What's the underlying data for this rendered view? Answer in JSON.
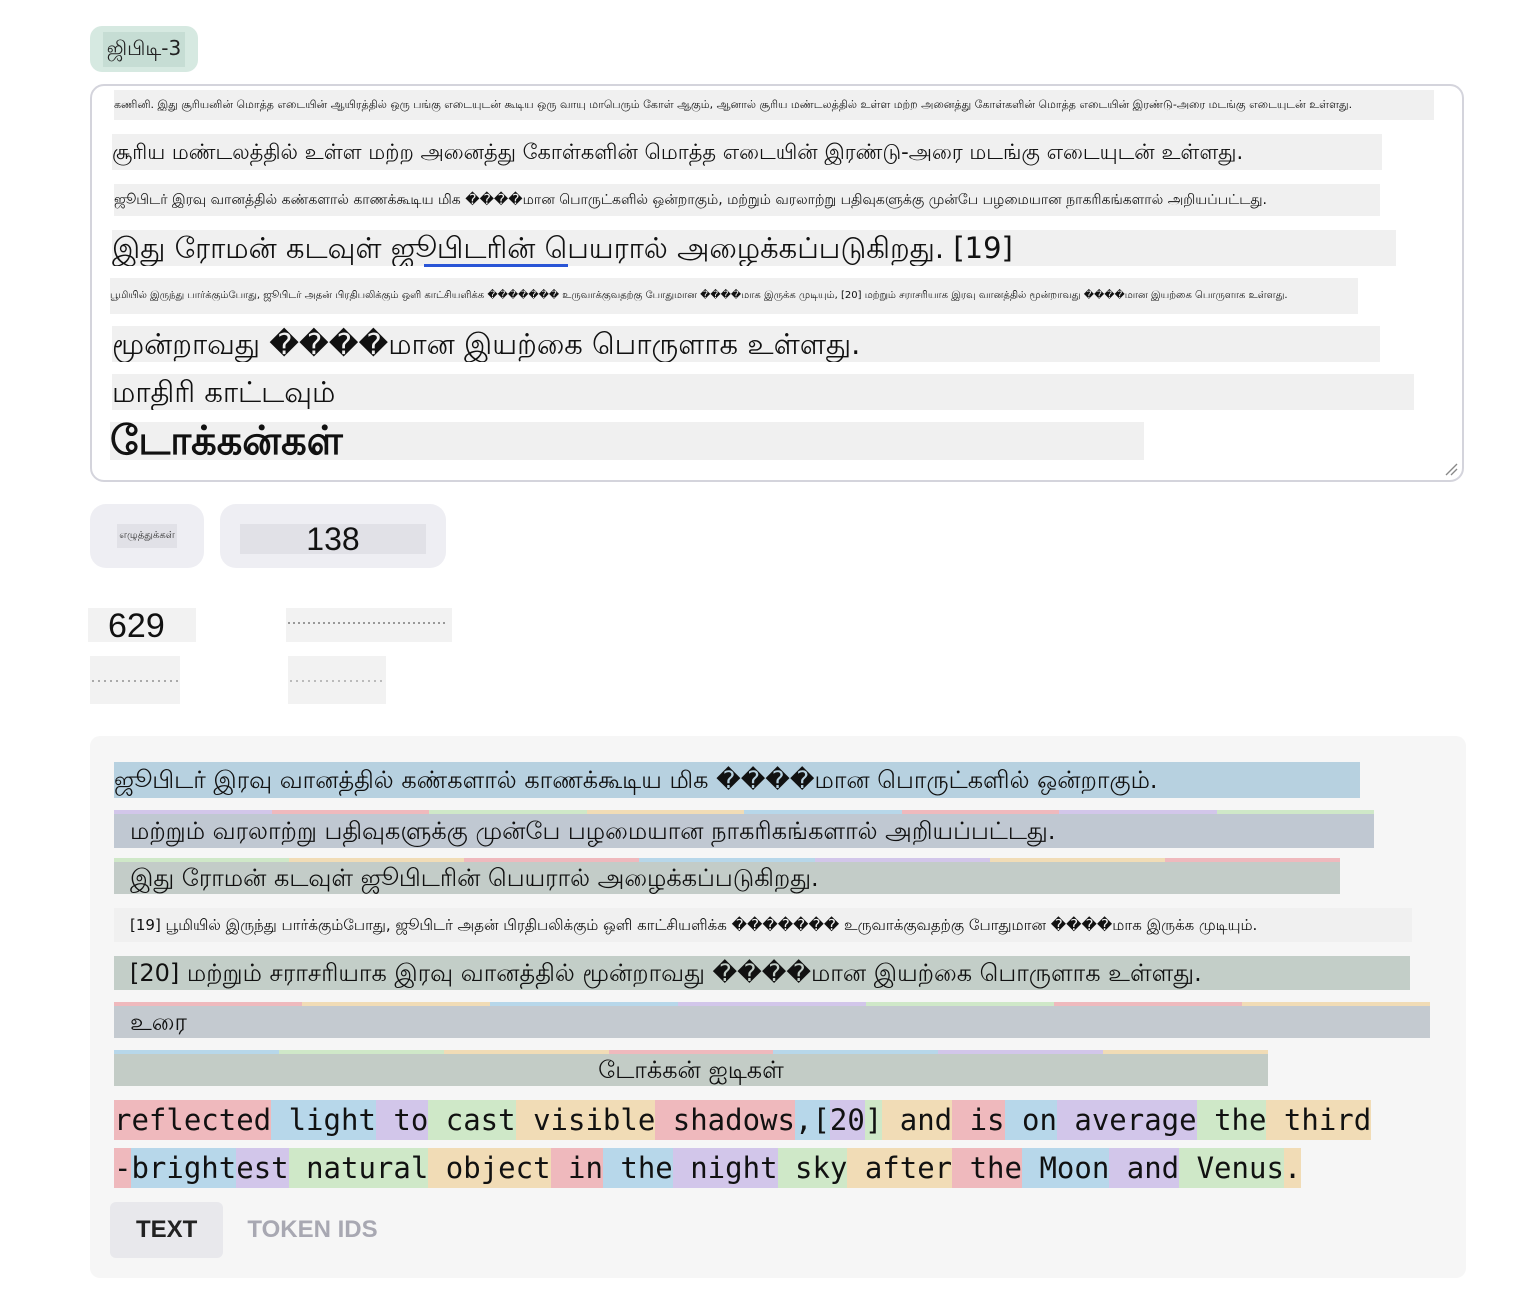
{
  "model_badge": "ஜிபிடி-3",
  "editor": {
    "lines": [
      "கணினி. இது சூரியனின் மொத்த எடையின் ஆயிரத்தில் ஒரு பங்கு எடையுடன் கூடிய ஒரு வாயு மாபெரும் கோள் ஆகும், ஆனால் சூரிய மண்டலத்தில் உள்ள மற்ற அனைத்து கோள்களின் மொத்த எடையின் இரண்டு-அரை மடங்கு எடையுடன் உள்ளது.",
      "சூரிய மண்டலத்தில் உள்ள மற்ற அனைத்து கோள்களின் மொத்த எடையின் இரண்டு-அரை மடங்கு எடையுடன் உள்ளது.",
      "ஜூபிடர் இரவு வானத்தில் கண்களால் காணக்கூடிய மிக ����மான பொருட்களில் ஒன்றாகும், மற்றும் வரலாற்று பதிவுகளுக்கு முன்பே பழமையான நாகரிகங்களால் அறியப்பட்டது.",
      "இது ரோமன் கடவுள் ஜூபிடரின் பெயரால் அழைக்கப்படுகிறது. [19]",
      "பூமியில் இருந்து பார்க்கும்போது, ஜூபிடர் அதன் பிரதிபலிக்கும் ஒளி காட்சியளிக்க ������� உருவாக்குவதற்கு போதுமான ����மாக இருக்க முடியும், [20] மற்றும் சராசரியாக இரவு வானத்தில் மூன்றாவது ����மான இயற்கை பொருளாக உள்ளது.",
      "மூன்றாவது ����மான இயற்கை பொருளாக உள்ளது.",
      "மாதிரி காட்டவும்",
      "டோக்கன்கள்"
    ]
  },
  "stats": {
    "chars_label": "எழுத்துக்கள்",
    "tokens_value": "138",
    "chars_value": "629"
  },
  "tokens_view": {
    "text_lines": [
      "ஜூபிடர் இரவு வானத்தில் கண்களால் காணக்கூடிய மிக ����மான பொருட்களில் ஒன்றாகும்.",
      "மற்றும் வரலாற்று பதிவுகளுக்கு முன்பே பழமையான நாகரிகங்களால் அறியப்பட்டது.",
      "இது ரோமன் கடவுள் ஜூபிடரின் பெயரால் அழைக்கப்படுகிறது.",
      "[19] பூமியில் இருந்து பார்க்கும்போது, ஜூபிடர் அதன் பிரதிபலிக்கும் ஒளி காட்சியளிக்க ������� உருவாக்குவதற்கு போதுமான ����மாக இருக்க முடியும்.",
      "[20] மற்றும் சராசரியாக இரவு வானத்தில் மூன்றாவது ����மான இயற்கை பொருளாக உள்ளது.",
      "உரை",
      "டோக்கன் ஐடிகள்"
    ],
    "row1_tokens": [
      "reflected",
      " light",
      " to",
      " cast",
      " visible",
      " shadows",
      ",[",
      "20",
      "]",
      " and",
      " is",
      " on",
      " average",
      " the",
      " third"
    ],
    "row2_tokens": [
      "-",
      "bright",
      "est",
      " natural",
      " object",
      " in",
      " the",
      " night",
      " sky",
      " after",
      " the",
      " Moon",
      " and",
      " Venus",
      "."
    ]
  },
  "tabs": {
    "text": "TEXT",
    "token_ids": "TOKEN IDS"
  },
  "colors": {
    "token_palette": [
      "#efb9bd",
      "#b7d7ea",
      "#d2c6ea",
      "#cfe8c8",
      "#f1dcb6"
    ],
    "link_underline": "#2a55d6"
  }
}
